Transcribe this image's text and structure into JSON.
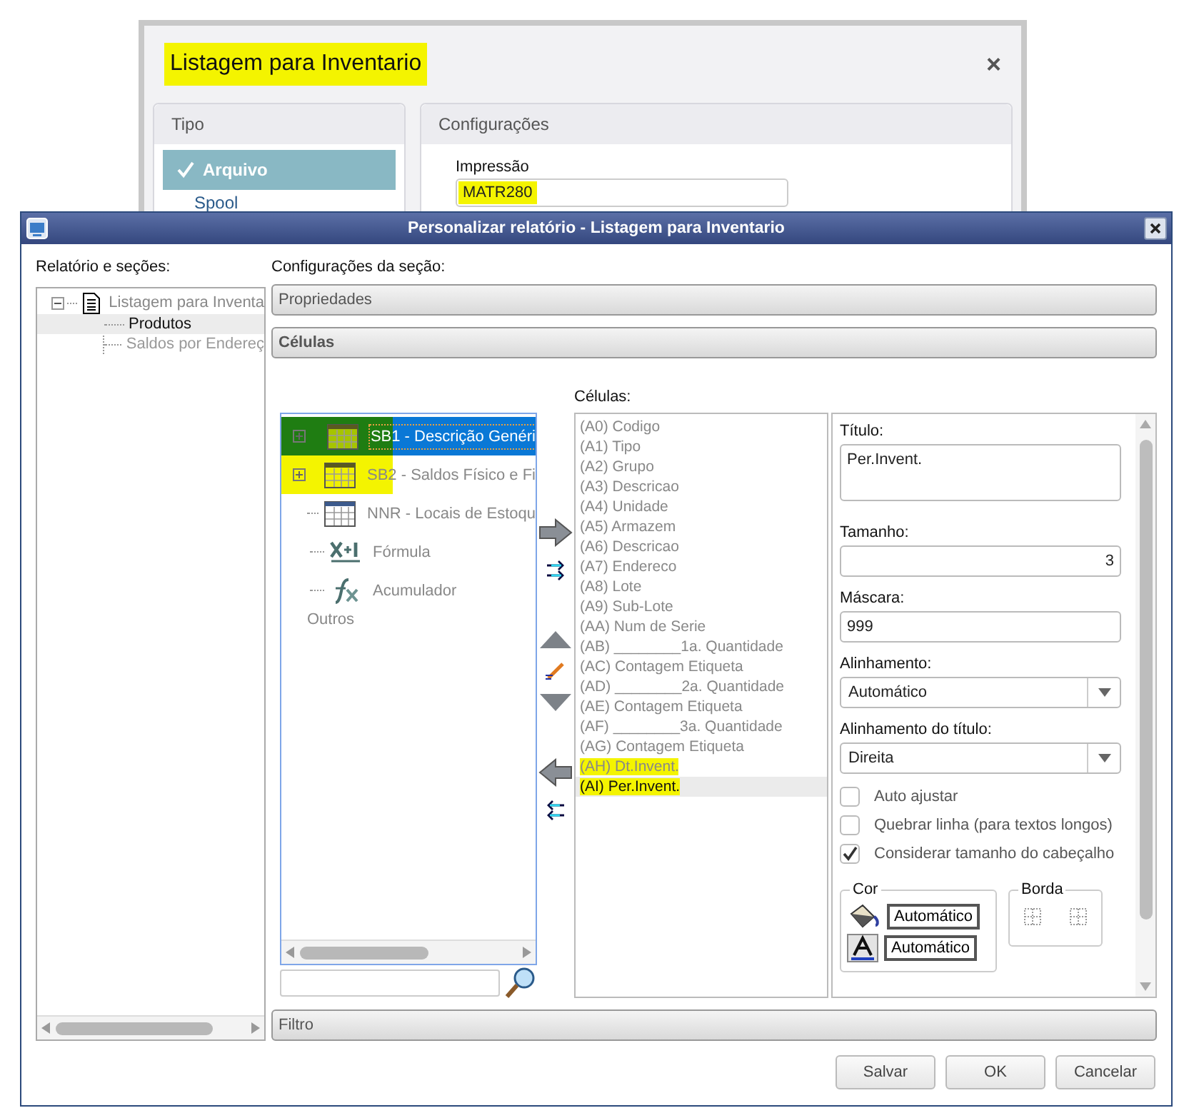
{
  "background_dialog": {
    "title": "Listagem para Inventario",
    "title_highlighted": true,
    "close": "×",
    "tipo": {
      "header": "Tipo",
      "items": [
        {
          "label": "Arquivo",
          "selected": true
        },
        {
          "label": "Spool",
          "selected": false
        }
      ]
    },
    "configuracoes": {
      "header": "Configurações",
      "field_label": "Impressão",
      "field_value": "MATR280",
      "value_highlighted": true
    }
  },
  "window": {
    "title": "Personalizar relatório - Listagem para Inventario"
  },
  "report_tree": {
    "label": "Relatório e seções:",
    "items": [
      {
        "label": "Listagem para Inventa",
        "expanded": true,
        "children": [
          {
            "label": "Produtos",
            "selected": true
          },
          {
            "label": "Saldos por Endereç",
            "selected": false
          }
        ]
      }
    ]
  },
  "section": {
    "label": "Configurações da seção:",
    "panels": [
      {
        "label": "Propriedades",
        "expanded": false
      },
      {
        "label": "Células",
        "expanded": true
      }
    ],
    "filter_panel": {
      "label": "Filtro",
      "expanded": false
    }
  },
  "tables_tree": [
    {
      "kind": "table",
      "label": "SB1 - Descrição Genéri",
      "selected": true,
      "highlighted": true
    },
    {
      "kind": "table",
      "label": "SB2 - Saldos Físico e Fi",
      "selected": false,
      "highlighted": true
    },
    {
      "kind": "table",
      "label": "NNR - Locais de Estoqu",
      "selected": false,
      "highlighted": false
    },
    {
      "kind": "formula",
      "label": "Fórmula",
      "selected": false,
      "highlighted": false
    },
    {
      "kind": "accumulator",
      "label": "Acumulador",
      "selected": false,
      "highlighted": false
    },
    {
      "kind": "other",
      "label": "Outros",
      "selected": false,
      "highlighted": false
    }
  ],
  "cells": {
    "label": "Células:",
    "items": [
      {
        "label": "(A0) Codigo",
        "selected": false,
        "highlighted": false
      },
      {
        "label": "(A1) Tipo",
        "selected": false,
        "highlighted": false
      },
      {
        "label": "(A2) Grupo",
        "selected": false,
        "highlighted": false
      },
      {
        "label": "(A3) Descricao",
        "selected": false,
        "highlighted": false
      },
      {
        "label": "(A4) Unidade",
        "selected": false,
        "highlighted": false
      },
      {
        "label": "(A5) Armazem",
        "selected": false,
        "highlighted": false
      },
      {
        "label": "(A6) Descricao",
        "selected": false,
        "highlighted": false
      },
      {
        "label": "(A7) Endereco",
        "selected": false,
        "highlighted": false
      },
      {
        "label": "(A8) Lote",
        "selected": false,
        "highlighted": false
      },
      {
        "label": "(A9) Sub-Lote",
        "selected": false,
        "highlighted": false
      },
      {
        "label": "(AA) Num de Serie",
        "selected": false,
        "highlighted": false
      },
      {
        "label": "(AB) ________1a. Quantidade",
        "selected": false,
        "highlighted": false
      },
      {
        "label": "(AC) Contagem Etiqueta",
        "selected": false,
        "highlighted": false
      },
      {
        "label": "(AD) ________2a. Quantidade",
        "selected": false,
        "highlighted": false
      },
      {
        "label": "(AE) Contagem Etiqueta",
        "selected": false,
        "highlighted": false
      },
      {
        "label": "(AF) ________3a. Quantidade",
        "selected": false,
        "highlighted": false
      },
      {
        "label": "(AG) Contagem Etiqueta",
        "selected": false,
        "highlighted": false
      },
      {
        "label": "(AH) Dt.Invent.",
        "selected": false,
        "highlighted": true
      },
      {
        "label": "(AI) Per.Invent.",
        "selected": true,
        "highlighted": true
      }
    ]
  },
  "properties": {
    "titulo": {
      "label": "Título:",
      "value": "Per.Invent."
    },
    "tamanho": {
      "label": "Tamanho:",
      "value": "3"
    },
    "mascara": {
      "label": "Máscara:",
      "value": "999"
    },
    "alinhamento": {
      "label": "Alinhamento:",
      "value": "Automático"
    },
    "alinhamento_titulo": {
      "label": "Alinhamento do título:",
      "value": "Direita"
    },
    "checkboxes": [
      {
        "label": "Auto ajustar",
        "checked": false
      },
      {
        "label": "Quebrar linha (para textos longos)",
        "checked": false
      },
      {
        "label": "Considerar tamanho do cabeçalho",
        "checked": true
      }
    ],
    "cor": {
      "label": "Cor",
      "background": "Automático",
      "font": "Automático"
    },
    "borda": {
      "label": "Borda"
    }
  },
  "buttons": [
    {
      "label": "Salvar"
    },
    {
      "label": "OK"
    },
    {
      "label": "Cancelar"
    }
  ]
}
